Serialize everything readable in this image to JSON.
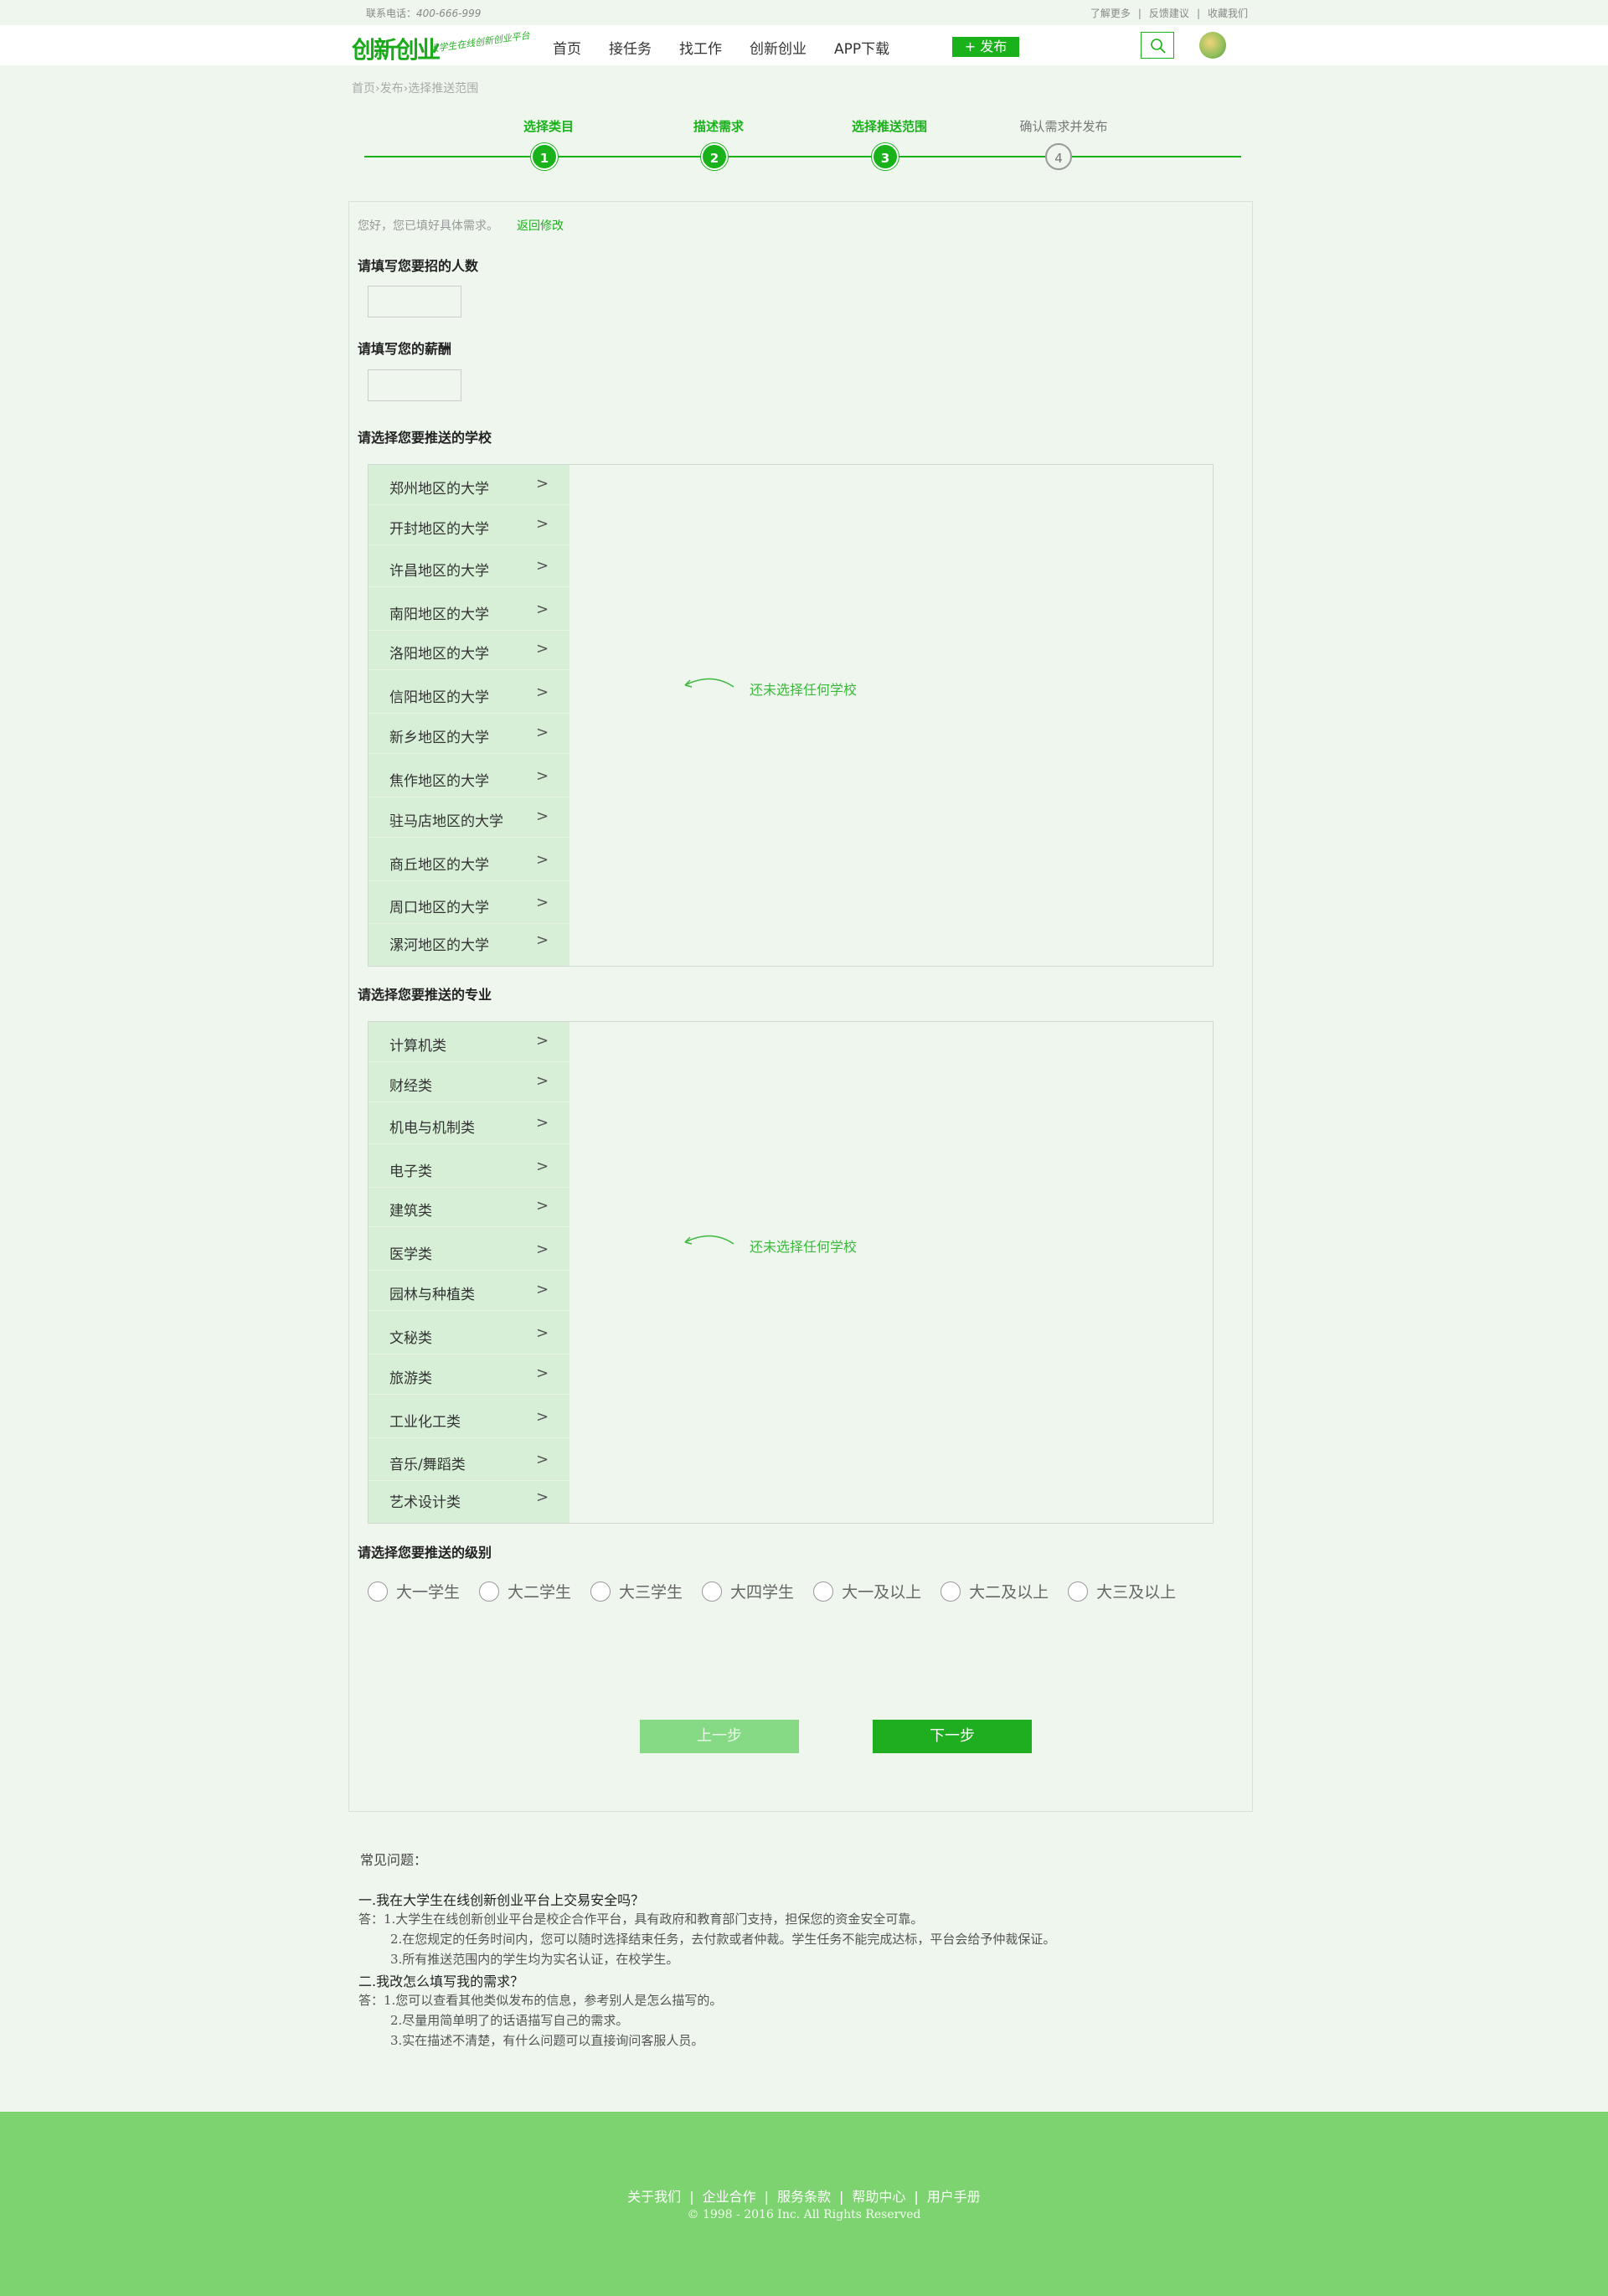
{
  "topbar": {
    "phone_label": "联系电话：",
    "phone_number": "400-666-999",
    "links": [
      "了解更多",
      "反馈建议",
      "收藏我们"
    ],
    "separator": "|"
  },
  "header": {
    "logo_text": "创新创业",
    "slogan": "大学生在线创新创业平台",
    "nav": [
      "首页",
      "接任务",
      "找工作",
      "创新创业",
      "APP下载"
    ],
    "publish_label": "+ 发布"
  },
  "breadcrumb": [
    "首页",
    "发布",
    "选择推送范围"
  ],
  "breadcrumb_sep": "›",
  "steps": [
    {
      "label": "选择类目",
      "num": "1",
      "state": "done"
    },
    {
      "label": "描述需求",
      "num": "2",
      "state": "done"
    },
    {
      "label": "选择推送范围",
      "num": "3",
      "state": "done"
    },
    {
      "label": "确认需求并发布",
      "num": "4",
      "state": "pending"
    }
  ],
  "form": {
    "greeting": "您好，您已填好具体需求。",
    "back_link": "返回修改",
    "headcount_title": "请填写您要招的人数",
    "salary_title": "请填写您的薪酬",
    "schools_title": "请选择您要推送的学校",
    "schools": [
      "郑州地区的大学",
      "开封地区的大学",
      "许昌地区的大学",
      "南阳地区的大学",
      "洛阳地区的大学",
      "信阳地区的大学",
      "新乡地区的大学",
      "焦作地区的大学",
      "驻马店地区的大学",
      "商丘地区的大学",
      "周口地区的大学",
      "漯河地区的大学"
    ],
    "schools_empty": "还未选择任何学校",
    "majors_title": "请选择您要推送的专业",
    "majors": [
      "计算机类",
      "财经类",
      "机电与机制类",
      "电子类",
      "建筑类",
      "医学类",
      "园林与种植类",
      "文秘类",
      "旅游类",
      "工业化工类",
      "音乐/舞蹈类",
      "艺术设计类"
    ],
    "majors_empty": "还未选择任何学校",
    "levels_title": "请选择您要推送的级别",
    "levels": [
      "大一学生",
      "大二学生",
      "大三学生",
      "大四学生",
      "大一及以上",
      "大二及以上",
      "大三及以上"
    ],
    "prev_label": "上一步",
    "next_label": "下一步",
    "chevron": ">"
  },
  "faq": {
    "title": "常见问题：",
    "lines": [
      {
        "kind": "q",
        "text": "一.我在大学生在线创新创业平台上交易安全吗？"
      },
      {
        "kind": "a",
        "text": "答：1.大学生在线创新创业平台是校企合作平台，具有政府和教育部门支持，担保您的资金安全可靠。"
      },
      {
        "kind": "a2",
        "text": "2.在您规定的任务时间内，您可以随时选择结束任务，去付款或者仲裁。学生任务不能完成达标，平台会给予仲裁保证。"
      },
      {
        "kind": "a2",
        "text": "3.所有推送范围内的学生均为实名认证，在校学生。"
      },
      {
        "kind": "q",
        "text": "二.我改怎么填写我的需求？"
      },
      {
        "kind": "a",
        "text": "答：1.您可以查看其他类似发布的信息，参考别人是怎么描写的。"
      },
      {
        "kind": "a2",
        "text": "2.尽量用简单明了的话语描写自己的需求。"
      },
      {
        "kind": "a2",
        "text": "3.实在描述不清楚，有什么问题可以直接询问客服人员。"
      }
    ]
  },
  "footer": {
    "links": [
      "关于我们",
      "企业合作",
      "服务条款",
      "帮助中心",
      "用户手册"
    ],
    "separator": "|",
    "copyright": "© 1998 - 2016  Inc. All Rights Reserved"
  },
  "colors": {
    "brand_green": "#1ab21a",
    "page_bg": "#eef6ee",
    "list_bg": "#d6efd6",
    "footer_bg": "#7dd36f"
  }
}
